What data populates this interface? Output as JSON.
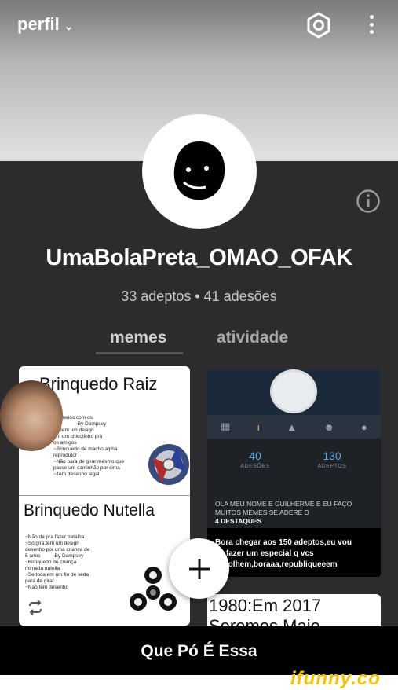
{
  "topbar": {
    "title": "perfil",
    "title_chevron": "chevron-down-icon",
    "settings_icon": "hexagon-settings-icon",
    "menu_icon": "more-vertical-icon"
  },
  "profile": {
    "username": "UmaBolaPreta_OMAO_OFAK",
    "stats": "33 adeptos  •  41 adesões",
    "info_icon": "info-icon"
  },
  "tabs": [
    {
      "label": "memes",
      "active": true
    },
    {
      "label": "atividade",
      "active": false
    }
  ],
  "card1": {
    "title_top": "Brinquedo Raiz",
    "title_bottom": "Brinquedo Nutella",
    "top_text": "r torneios com os\n                 By Dampsey\nha,tem um design\nom um chicotinho pra\nos amigos\n~Brinquedo de macho alpha\nreprodutor\n~Não para de girar mesmo que\npasse um caminhão por cima\n~Tem desenho legal",
    "bottom_text": "~Não da pra fazer batalha\n~Só gira,tem um design\ndesenho por uma criança de\n5 anos          By Dampsey\n~Brinquedo de criança\nmimada nutella\n~Se toca em um fio de seda\npara de girar\n~Não tem desenho"
  },
  "card2": {
    "adesoes_value": "40",
    "adesoes_label": "ADESÕES",
    "adeptos_value": "130",
    "adeptos_label": "ADEPTOS",
    "bio": "OLA MEU NOME E GUILHERME E EU FAÇO\nMUITOS MEMES SE ADERE D",
    "highlights": "4 DESTAQUES",
    "overlay": "Bora chegar aos 150 adeptos,eu vou\n     fazer um especial q vcs\nescolhem,boraaa,republiqueeem"
  },
  "card3": {
    "line1": "1980:Em 2017",
    "line2": "Seremos Maio"
  },
  "caption": "Que Pó É Essa",
  "watermark": "ifunny.co",
  "colors": {
    "accent_gold": "#e7b53b",
    "stat_blue": "#5aa9e6",
    "watermark_yellow": "#f7c300"
  }
}
